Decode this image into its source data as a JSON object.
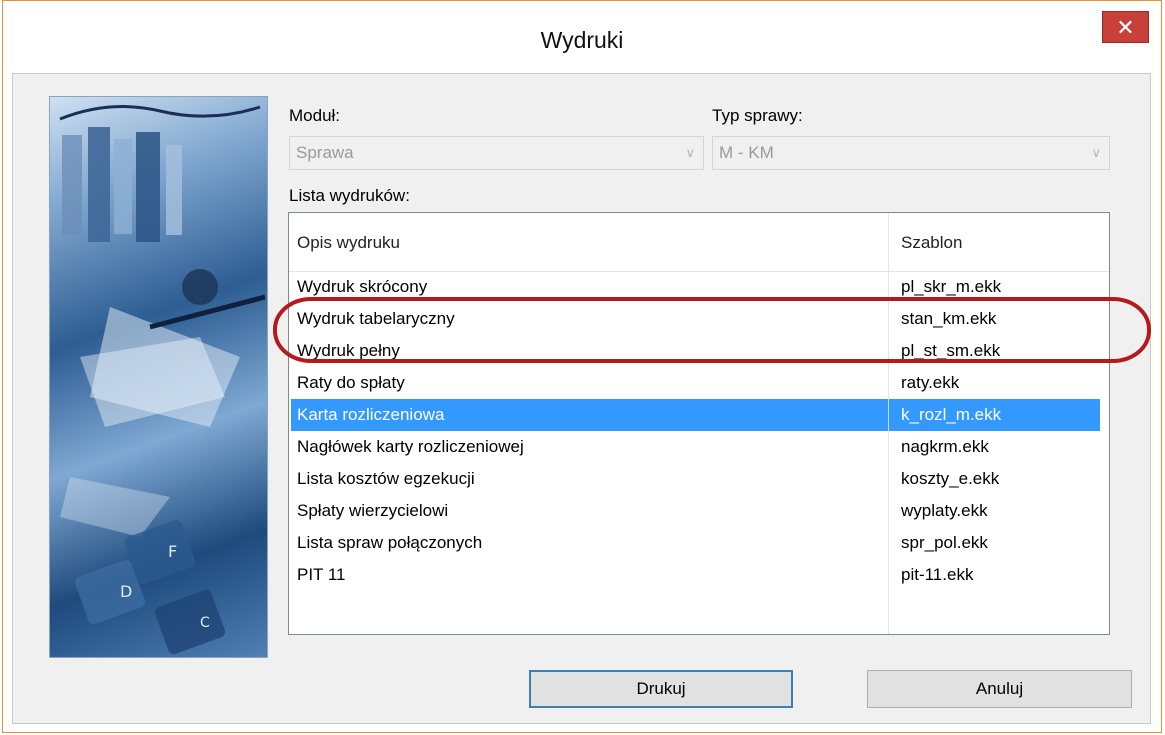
{
  "window": {
    "title": "Wydruki",
    "close_symbol": "✕"
  },
  "form": {
    "module_label": "Moduł:",
    "module_value": "Sprawa",
    "case_type_label": "Typ sprawy:",
    "case_type_value": "M - KM",
    "list_label": "Lista wydruków:"
  },
  "list": {
    "columns": [
      "Opis wydruku",
      "Szablon"
    ],
    "rows": [
      {
        "desc": "Wydruk skrócony",
        "template": "pl_skr_m.ekk"
      },
      {
        "desc": "Wydruk tabelaryczny",
        "template": "stan_km.ekk"
      },
      {
        "desc": "Wydruk pełny",
        "template": "pl_st_sm.ekk"
      },
      {
        "desc": "Raty do spłaty",
        "template": "raty.ekk"
      },
      {
        "desc": "Karta rozliczeniowa",
        "template": "k_rozl_m.ekk"
      },
      {
        "desc": "Nagłówek karty rozliczeniowej",
        "template": "nagkrm.ekk"
      },
      {
        "desc": "Lista kosztów egzekucji",
        "template": "koszty_e.ekk"
      },
      {
        "desc": "Spłaty wierzycielowi",
        "template": "wyplaty.ekk"
      },
      {
        "desc": "Lista spraw połączonych",
        "template": "spr_pol.ekk"
      },
      {
        "desc": "PIT 11",
        "template": "pit-11.ekk"
      }
    ],
    "selected_index": 4
  },
  "buttons": {
    "print": "Drukuj",
    "cancel": "Anuluj"
  },
  "colors": {
    "selection": "#3399ff",
    "close": "#c7413a",
    "annotation": "#b4191e",
    "frame": "#e8913a"
  }
}
